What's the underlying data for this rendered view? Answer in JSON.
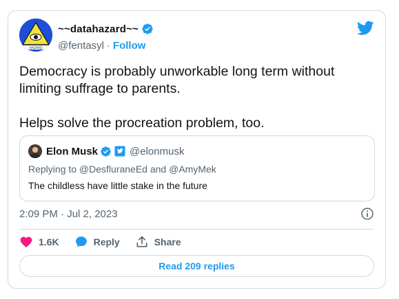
{
  "tweet": {
    "author": {
      "display_name": "~~datahazard~~",
      "handle": "@fentasyl",
      "follow_label": "Follow",
      "separator": "·"
    },
    "text": "Democracy is probably unworkable long term without limiting suffrage to parents.\n\nHelps solve the procreation problem, too.",
    "quoted": {
      "display_name": "Elon Musk",
      "handle": "@elonmusk",
      "replying_to": "Replying to @DesfluraneEd and @AmyMek",
      "text": "The childless have little stake in the future"
    },
    "timestamp": "2:09 PM · Jul 2, 2023",
    "actions": {
      "likes": "1.6K",
      "reply_label": "Reply",
      "share_label": "Share"
    },
    "read_replies_label": "Read 209 replies"
  },
  "colors": {
    "accent": "#1d9bf0",
    "like": "#f91880",
    "text": "#0f1419",
    "secondary": "#536471",
    "border": "#cfd9de"
  },
  "icons": [
    "verified-badge-icon",
    "twitter-bird-icon",
    "info-icon",
    "heart-icon",
    "reply-bubble-icon",
    "share-icon",
    "affiliation-badge-icon"
  ]
}
